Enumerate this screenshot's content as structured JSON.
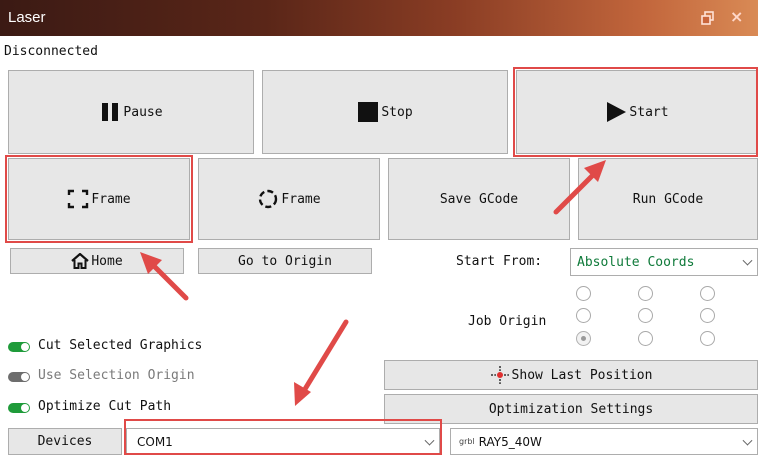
{
  "window": {
    "title": "Laser",
    "restore_icon": "restore-icon",
    "close_icon": "close-icon",
    "close_glyph": "×"
  },
  "status": "Disconnected",
  "buttons": {
    "pause": "Pause",
    "stop": "Stop",
    "start": "Start",
    "frame_rect": "Frame",
    "frame_circle": "Frame",
    "save_gcode": "Save GCode",
    "run_gcode": "Run GCode",
    "home": "Home",
    "go_to_origin": "Go to Origin",
    "show_last_position": "Show Last Position",
    "optimization_settings": "Optimization Settings",
    "devices": "Devices"
  },
  "start_from": {
    "label": "Start From:",
    "value": "Absolute Coords"
  },
  "job_origin": {
    "label": "Job Origin",
    "selected": "bottom-left"
  },
  "toggles": [
    {
      "label": "Cut Selected Graphics",
      "on": true
    },
    {
      "label": "Use Selection Origin",
      "on": false
    },
    {
      "label": "Optimize Cut Path",
      "on": true
    }
  ],
  "port": {
    "value": "COM1"
  },
  "profile": {
    "tag": "grbl",
    "value": "RAY5_40W"
  },
  "colors": {
    "highlight": "#e04a48",
    "toggle_on": "#1f9b3a",
    "start_from_value": "#0f7a3a",
    "button_face": "#e7e7e7"
  }
}
